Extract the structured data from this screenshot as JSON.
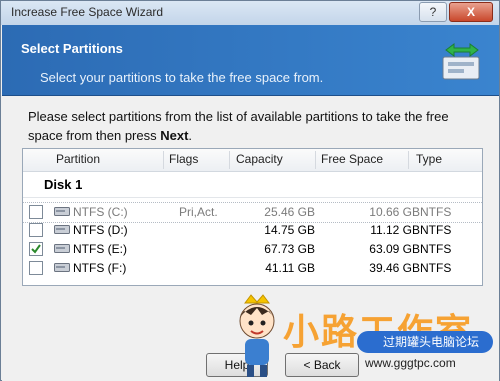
{
  "window": {
    "title": "Increase Free Space Wizard",
    "help_btn": "?",
    "close_btn": "X"
  },
  "header": {
    "title": "Select Partitions",
    "subtitle": "Select your partitions to take the free space from."
  },
  "instructions": {
    "text": "Please select partitions from the list of available partitions to take the free space from then press ",
    "bold": "Next",
    "end": "."
  },
  "table": {
    "columns": [
      "Partition",
      "Flags",
      "Capacity",
      "Free Space",
      "Type"
    ],
    "disk_label": "Disk 1",
    "rows": [
      {
        "checked": false,
        "partition": "NTFS (C:)",
        "flags": "Pri,Act.",
        "capacity": "25.46 GB",
        "free": "10.66 GB",
        "type": "NTFS",
        "dim": true
      },
      {
        "checked": false,
        "partition": "NTFS (D:)",
        "flags": "",
        "capacity": "14.75 GB",
        "free": "11.12 GB",
        "type": "NTFS",
        "dim": false
      },
      {
        "checked": true,
        "partition": "NTFS (E:)",
        "flags": "",
        "capacity": "67.73 GB",
        "free": "63.09 GB",
        "type": "NTFS",
        "dim": false
      },
      {
        "checked": false,
        "partition": "NTFS (F:)",
        "flags": "",
        "capacity": "41.11 GB",
        "free": "39.46 GB",
        "type": "NTFS",
        "dim": false
      }
    ]
  },
  "buttons": {
    "help": "Help",
    "back": "< Back"
  },
  "watermark": {
    "text": "小路工作室",
    "badge": "过期罐头电脑论坛",
    "url": "www.gggtpc.com"
  }
}
